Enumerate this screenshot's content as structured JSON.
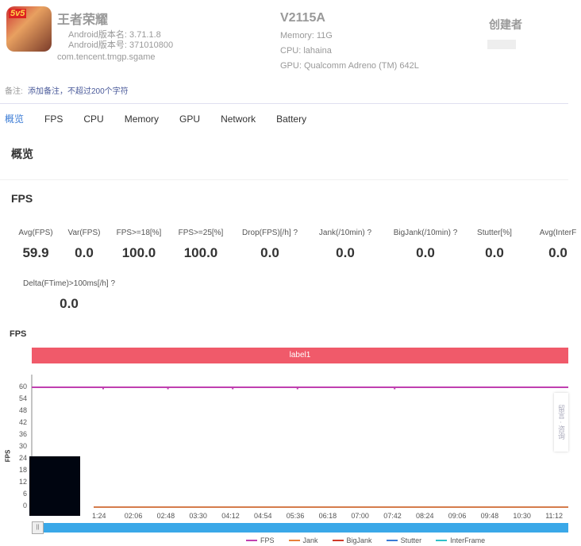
{
  "app": {
    "name": "王者荣耀",
    "icon_badge": "5v5",
    "version_name": "Android版本名: 3.71.1.8",
    "version_code": "Android版本号: 371010800",
    "package": "com.tencent.tmgp.sgame"
  },
  "device": {
    "model": "V2115A",
    "memory": "Memory: 11G",
    "cpu": "CPU: lahaina",
    "gpu": "GPU: Qualcomm Adreno (TM) 642L"
  },
  "creator": {
    "label": "创建者"
  },
  "note": {
    "label": "备注:",
    "link": "添加备注，不超过200个字符"
  },
  "tabs": [
    {
      "label": "概览",
      "active": true
    },
    {
      "label": "FPS"
    },
    {
      "label": "CPU"
    },
    {
      "label": "Memory"
    },
    {
      "label": "GPU"
    },
    {
      "label": "Network"
    },
    {
      "label": "Battery"
    }
  ],
  "overview_title": "概览",
  "fps_section_title": "FPS",
  "metrics": [
    {
      "label": "Avg(FPS)",
      "value": "59.9"
    },
    {
      "label": "Var(FPS)",
      "value": "0.0"
    },
    {
      "label": "FPS>=18[%]",
      "value": "100.0"
    },
    {
      "label": "FPS>=25[%]",
      "value": "100.0"
    },
    {
      "label": "Drop(FPS)[/h] ?",
      "value": "0.0"
    },
    {
      "label": "Jank(/10min) ?",
      "value": "0.0"
    },
    {
      "label": "BigJank(/10min) ?",
      "value": "0.0"
    },
    {
      "label": "Stutter[%]",
      "value": "0.0"
    },
    {
      "label": "Avg(InterF",
      "value": "0.0"
    },
    {
      "label": "Delta(FTime)>100ms[/h] ?",
      "value": "0.0"
    }
  ],
  "side_widget": "留言 · 咨询",
  "chart_data": {
    "type": "line",
    "title": "FPS",
    "band_label": "label1",
    "ylabel": "FPS",
    "ylim": [
      0,
      60
    ],
    "yticks": [
      "0",
      "6",
      "12",
      "18",
      "24",
      "30",
      "36",
      "42",
      "48",
      "54",
      "60"
    ],
    "xticks": [
      "1:24",
      "02:06",
      "02:48",
      "03:30",
      "04:12",
      "04:54",
      "05:36",
      "06:18",
      "07:00",
      "07:42",
      "08:24",
      "09:06",
      "09:48",
      "10:30",
      "11:12"
    ],
    "series": [
      {
        "name": "FPS",
        "color": "#c040b0",
        "value": 60,
        "dips": [
          "1:24",
          "02:48",
          "04:12",
          "05:36",
          "07:42"
        ]
      },
      {
        "name": "Jank",
        "color": "#e8803a",
        "value": 0
      },
      {
        "name": "BigJank",
        "color": "#d03a2a",
        "value": 0
      },
      {
        "name": "Stutter",
        "color": "#3a7bd5",
        "value": 0
      },
      {
        "name": "InterFrame",
        "color": "#30c0c8",
        "value": 0
      }
    ]
  }
}
